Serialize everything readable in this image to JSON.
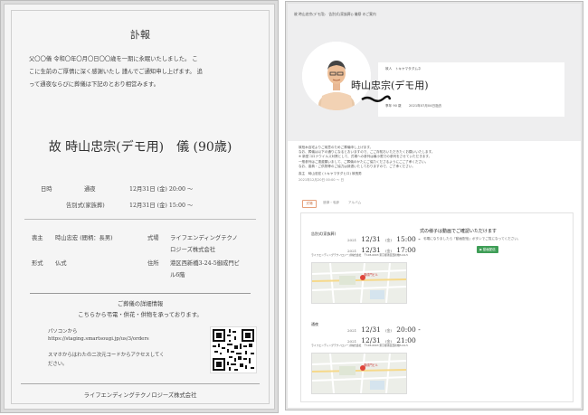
{
  "notice": {
    "title": "訃報",
    "body_lines": [
      "父〇〇儀 令和〇年〇月〇日〇〇歳を一期に永眠いたしました。 こ",
      "こに生前のご厚情に深く感謝いたし 謹んでご通知申し上げます。 追",
      "って通夜ならびに葬儀は下記のとおり相営みます。"
    ],
    "deceased_name": "故 時山忠宗(デモ用)　儀 (90歳)",
    "schedule": {
      "label": "日時",
      "rows": [
        {
          "event": "通夜",
          "datetime": "12月31日 (金) 20:00 〜"
        },
        {
          "event": "告別式(家族葬)",
          "datetime": "12月31日 (金) 15:00 〜"
        }
      ]
    },
    "details": {
      "chief_mourner_label": "喪主",
      "chief_mourner": "時山忠宏 (間柄：長男)",
      "venue_label": "式場",
      "venue_lines": [
        "ライフエンディングテクノ",
        "ロジーズ株式会社"
      ],
      "form_label": "形式",
      "form": "仏式",
      "address_label": "住所",
      "address_lines": [
        "港区西新橋3-24-5御成門ビ",
        "ル6階"
      ]
    },
    "info_heading": "ご葬儀の詳細情報",
    "info_sub": "こちらから弔電・供花・供物を承っております。",
    "pc_label": "パソコンから",
    "pc_url": "https://staging.smartsougi.jp/us/3/orders",
    "phone_lines": [
      "スマホからはわたの二次元コードからアクセスしてく",
      "ださい。"
    ],
    "footer": "ライフエンディングテクノロジーズ株式会社"
  },
  "web": {
    "header_title": "故 時山忠宗(デモ用)　告別式(家族葬)) 儀祭 のご案内",
    "kana": "故人　トキヤマタダムネ",
    "name": "時山忠宗(デモ用)",
    "age": "享年 90 歳",
    "date": "2021年07月04日逝去",
    "message_lines": [
      "故柏木自宅よりご用意のためご葬儀申し上げます。",
      "なお、葬儀は以下の通りになるとおいますので、ごご存知おいただきたくお願いいたします。",
      "※ 新型コロナウイルス対策として、式場への参列は最小限での参列をさせていただきます。",
      "一般参列はご遠慮願いまして、ご葬儀のかたにご協力くださるようにごご了承ください。",
      "なお、香典・ご供物等のご協力は辞退いたしておりますので、ご了承ください。"
    ],
    "message_sign": "喪主　時山忠宏 (トキヤマタダヒロ) 故長男",
    "message_date": "2021年12月20日 00:00 〜 日",
    "tabs": [
      "式場",
      "追悼・弔辞",
      "アルバム"
    ],
    "sections": [
      {
        "label": "告別式(家族葬)",
        "start_date": "2021",
        "start_md": "12/31",
        "start_dow": "(金)",
        "start_time": "15:00 -",
        "end_md": "12/31",
        "end_dow": "(金)",
        "end_time": "17:00",
        "place": "ライフエンディングテクノロジーズ株式会社　〒105-0003 東京都港区西新橋3-24-5",
        "map_pin": "御成門ビル"
      },
      {
        "label": "通夜",
        "start_date": "2021",
        "start_md": "12/31",
        "start_dow": "(金)",
        "start_time": "20:00 -",
        "end_md": "12/31",
        "end_dow": "(金)",
        "end_time": "21:00",
        "place": "ライフエンディングテクノロジーズ株式会社　〒105-0003 東京都港区西新橋3-24-5",
        "map_pin": "御成門ビル"
      }
    ],
    "video_heading": "式の様子は動画でご確認いただけます",
    "video_sub": "弔電になりましたら「動画配信」ボタンでご覧になってください。",
    "video_button": "▶ 動画配信",
    "accent_color": "#c56a3c",
    "button_color": "#3f9e57"
  }
}
